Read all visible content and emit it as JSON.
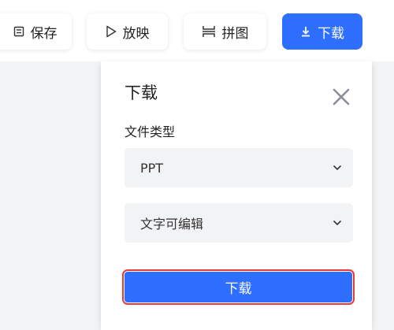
{
  "toolbar": {
    "save_label": "保存",
    "play_label": "放映",
    "puzzle_label": "拼图",
    "download_label": "下载"
  },
  "download_panel": {
    "title": "下载",
    "file_type_label": "文件类型",
    "file_type_value": "PPT",
    "mode_value": "文字可编辑",
    "confirm_label": "下载"
  },
  "colors": {
    "accent": "#2f6fff",
    "highlight_border": "#e53935",
    "select_bg": "#f2f3f5"
  }
}
